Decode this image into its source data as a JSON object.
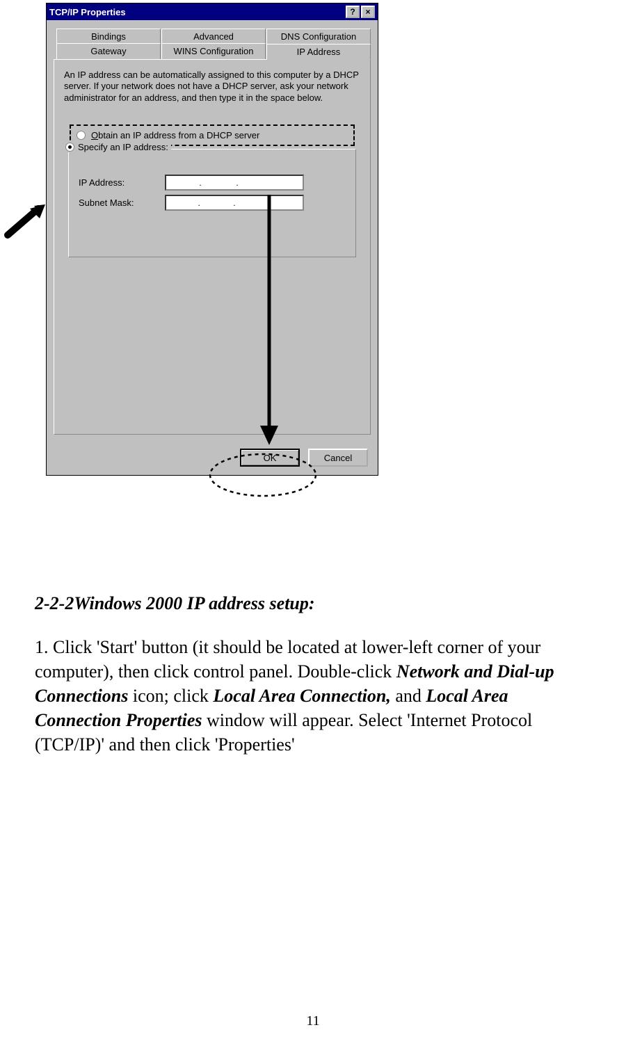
{
  "dialog": {
    "title": "TCP/IP Properties",
    "help_glyph": "?",
    "close_glyph": "×",
    "tabs_row1": [
      "Bindings",
      "Advanced",
      "DNS Configuration"
    ],
    "tabs_row2": [
      "Gateway",
      "WINS Configuration",
      "IP Address"
    ],
    "info": "An IP address can be automatically assigned to this computer by a DHCP server. If your network does not have a DHCP server, ask your network administrator for an address, and then type it in the space below.",
    "radio_dhcp_prefix": "O",
    "radio_dhcp_label": "btain an IP address from a DHCP server",
    "radio_specify_prefix": "S",
    "radio_specify_label": "pecify an IP address:",
    "ip_label_prefix": "I",
    "ip_label_rest": "P Address:",
    "subnet_label_prefix": "u",
    "subnet_label_before": "S",
    "subnet_label_after": "bnet Mask:",
    "ip_dots": ".",
    "ok": "OK",
    "cancel": "Cancel"
  },
  "doc": {
    "heading": "2-2-2Windows 2000 IP address setup:",
    "p_a": "1. Click 'Start' button (it should be located at lower-left corner of your computer), then click control panel. Double-click ",
    "p_b": "Network and Dial-up Connections",
    "p_c": " icon; click ",
    "p_d": "Local Area Connection,",
    "p_e": " and ",
    "p_f": "Local Area Connection Properties",
    "p_g": " window will appear. Select 'Internet Protocol (TCP/IP)' and then click 'Properties'"
  },
  "page_number": "11"
}
